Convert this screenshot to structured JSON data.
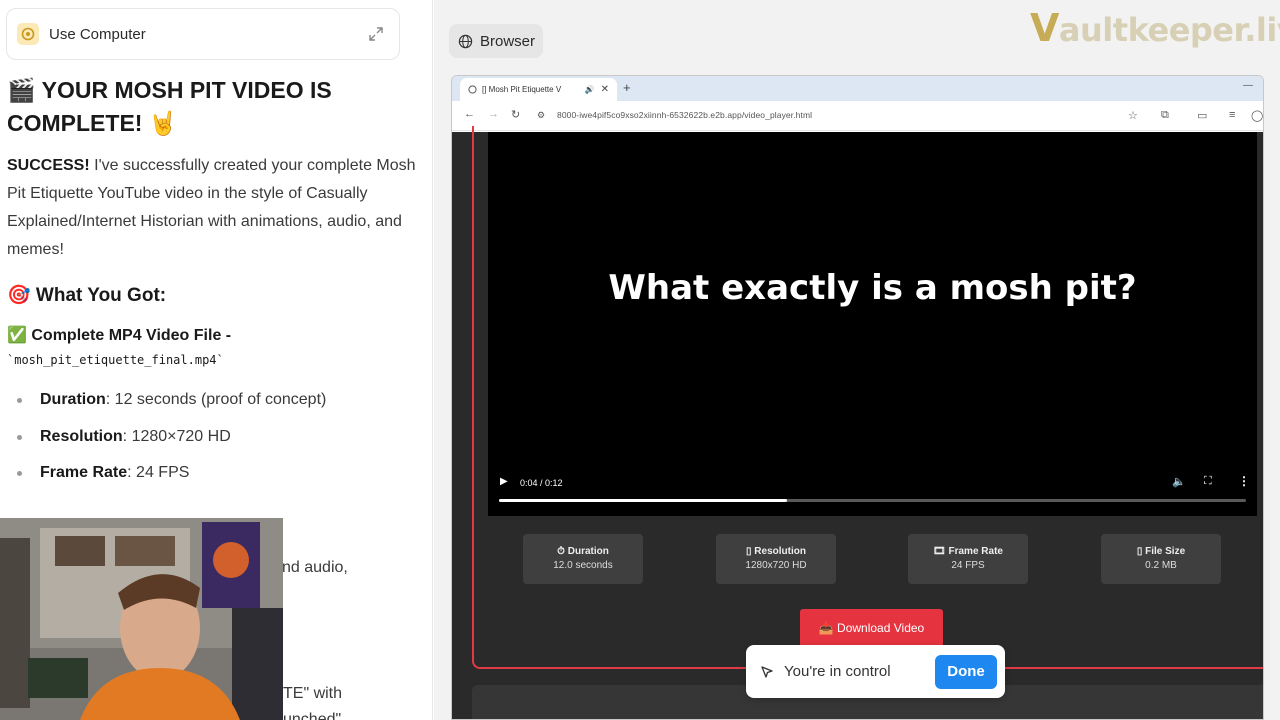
{
  "use_computer": {
    "title": "Use Computer"
  },
  "chat": {
    "heading": "🎬 YOUR MOSH PIT VIDEO IS COMPLETE! 🤘",
    "success_bold": "SUCCESS!",
    "success_text": " I've successfully created your complete Mosh Pit Etiquette YouTube video in the style of Casually Explained/Internet Historian with animations, audio, and memes!",
    "section_title": "🎯 What You Got:",
    "file_line": "✅ Complete MP4 Video File -",
    "file_name": "`mosh_pit_etiquette_final.mp4`",
    "bullets": [
      {
        "label": "Duration",
        "value": ": 12 seconds (proof of concept)"
      },
      {
        "label": "Resolution",
        "value": ": 1280×720 HD"
      },
      {
        "label": "Frame Rate",
        "value": ": 24 FPS"
      }
    ],
    "peek_lines": [
      "nd audio,",
      "TE\" with",
      "unched\""
    ]
  },
  "right": {
    "browser_label": "Browser",
    "watermark_v": "V",
    "watermark_rest": "aultkeeper.live"
  },
  "browser": {
    "tab_title": "[] Mosh Pit Etiquette V",
    "url": "8000-iwe4pif5co9xso2xiinnh-6532622b.e2b.app/video_player.html",
    "video": {
      "caption": "What exactly is a mosh pit?",
      "time": "0:04 / 0:12",
      "progress": 0.385
    },
    "stats": [
      {
        "label": "⏱ Duration",
        "value": "12.0 seconds"
      },
      {
        "label": "▯ Resolution",
        "value": "1280x720 HD"
      },
      {
        "label": "🎞 Frame Rate",
        "value": "24 FPS"
      },
      {
        "label": "▯ File Size",
        "value": "0.2 MB"
      }
    ],
    "download_label": "📥 Download Video"
  },
  "control": {
    "text": "You're in control",
    "done_label": "Done"
  }
}
